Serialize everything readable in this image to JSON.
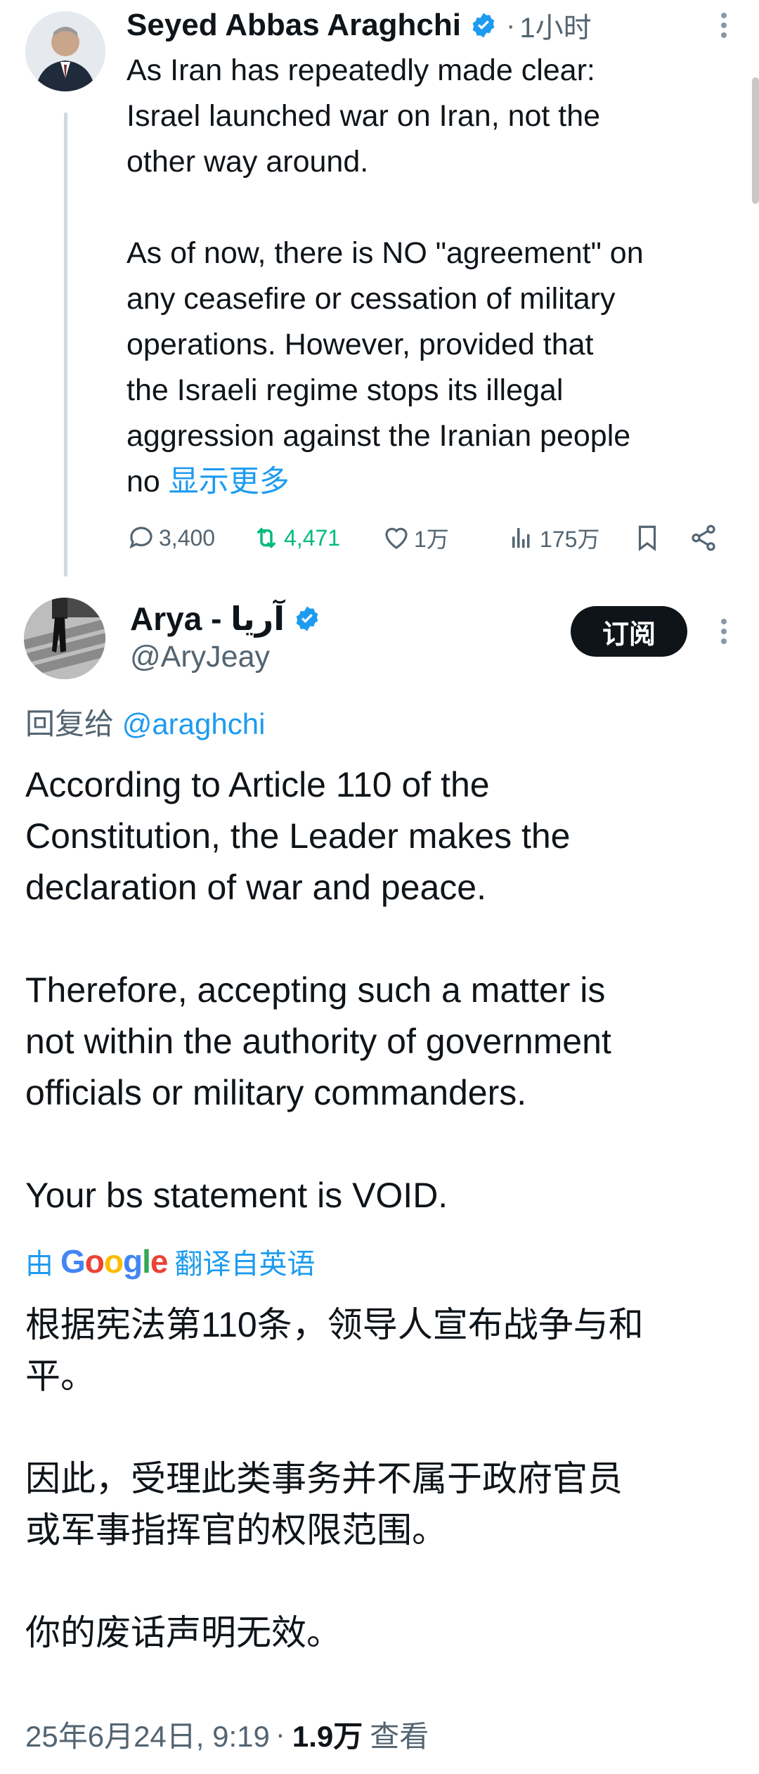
{
  "tweet1": {
    "author_name": "Seyed Abbas Araghchi",
    "separator": "·",
    "time": "1小时",
    "text": "As Iran has repeatedly made clear:\nIsrael launched war on Iran, not the\nother way around.\n\nAs of now, there is NO \"agreement\" on\nany ceasefire or cessation of military\noperations. However, provided that\nthe Israeli regime stops its illegal\naggression against the Iranian people\nno ",
    "show_more": "显示更多",
    "stats": {
      "replies": "3,400",
      "retweets": "4,471",
      "likes": "1万",
      "views": "175万"
    }
  },
  "tweet2": {
    "author_name": "Arya - آریا",
    "handle": "@AryJeay",
    "subscribe_label": "订阅",
    "reply_prefix": "回复给",
    "reply_mention": "@araghchi",
    "text": "According to Article 110 of the\nConstitution, the Leader makes the\ndeclaration of war and peace.\n\nTherefore, accepting such a matter is\nnot within the authority of government\nofficials or military commanders.\n\nYour bs statement is VOID.",
    "translate_prefix": "由",
    "translate_brand": "Google",
    "translate_suffix": "翻译自英语",
    "translated_text": "根据宪法第110条，领导人宣布战争与和\n平。\n\n因此，受理此类事务并不属于政府官员\n或军事指挥官的权限范围。\n\n你的废话声明无效。",
    "timestamp": "25年6月24日, 9:19",
    "separator": "·",
    "views_count": "1.9万",
    "views_label": "查看"
  },
  "colors": {
    "accent": "#1d9bf0",
    "retweet": "#00ba7c",
    "secondary_text": "#536471",
    "primary_text": "#0f1419"
  }
}
